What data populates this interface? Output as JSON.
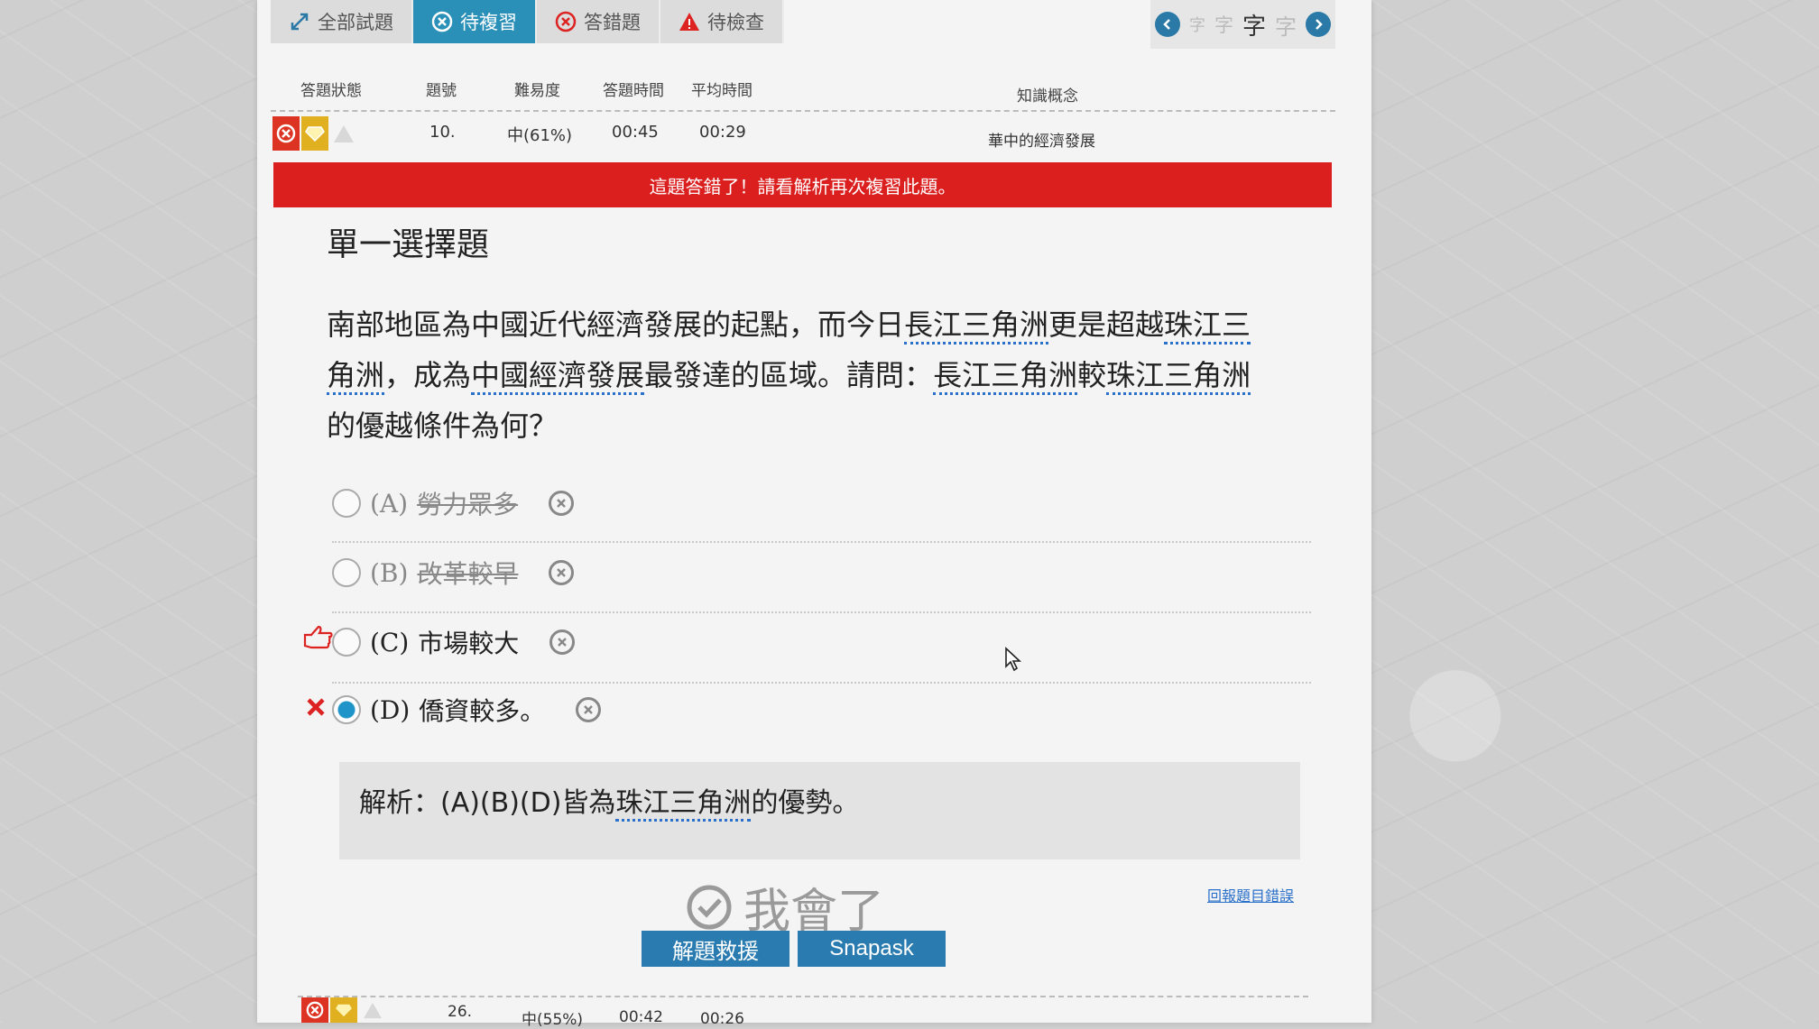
{
  "tabs": [
    {
      "label": "全部試題",
      "icon": "expand-arrows-icon",
      "active": false
    },
    {
      "label": "待複習",
      "icon": "x-circle-icon",
      "active": true
    },
    {
      "label": "答錯題",
      "icon": "x-circle-icon",
      "active": false
    },
    {
      "label": "待檢查",
      "icon": "warning-icon",
      "active": false
    }
  ],
  "font_size_control": {
    "small": "字",
    "medium": "字",
    "large": "字",
    "last": "字"
  },
  "table": {
    "headers": {
      "status": "答題狀態",
      "number": "題號",
      "difficulty": "難易度",
      "answer_time": "答題時間",
      "avg_time": "平均時間",
      "concept": "知識概念"
    },
    "rows": [
      {
        "number": "10.",
        "difficulty": "中(61%)",
        "answer_time": "00:45",
        "avg_time": "00:29",
        "concept": "華中的經濟發展"
      },
      {
        "number": "26.",
        "difficulty": "中(55%)",
        "answer_time": "00:42",
        "avg_time": "00:26",
        "concept": ""
      }
    ]
  },
  "banner": "這題答錯了！請看解析再次複習此題。",
  "question": {
    "type": "單一選擇題",
    "parts": [
      "南部地區為中國近代經濟發展的起點，而今日",
      "長江三角洲",
      "更是超越",
      "珠江三角洲",
      "，成為",
      "中國經濟發展",
      "最發達的區域。請問：",
      "長江三角洲",
      "較",
      "珠江三角洲",
      "的優越條件為何？"
    ]
  },
  "options": [
    {
      "letter": "(A)",
      "text": "勞力眾多",
      "struck": true,
      "selected": false,
      "marker": ""
    },
    {
      "letter": "(B)",
      "text": "改革較早",
      "struck": true,
      "selected": false,
      "marker": ""
    },
    {
      "letter": "(C)",
      "text": "市場較大",
      "struck": false,
      "selected": false,
      "marker": "correct-hand"
    },
    {
      "letter": "(D)",
      "text": "僑資較多。",
      "struck": false,
      "selected": true,
      "marker": "wrong-x"
    }
  ],
  "explanation": {
    "prefix": "解析：(A)(B)(D)皆為",
    "term": "珠江三角洲",
    "suffix": "的優勢。"
  },
  "understood": "我會了",
  "report_link": "回報題目錯誤",
  "buttons": {
    "help": "解題救援",
    "snapask": "Snapask"
  },
  "colors": {
    "accent": "#2a90b8",
    "error": "#db1e1e",
    "button": "#2a7bb0"
  }
}
